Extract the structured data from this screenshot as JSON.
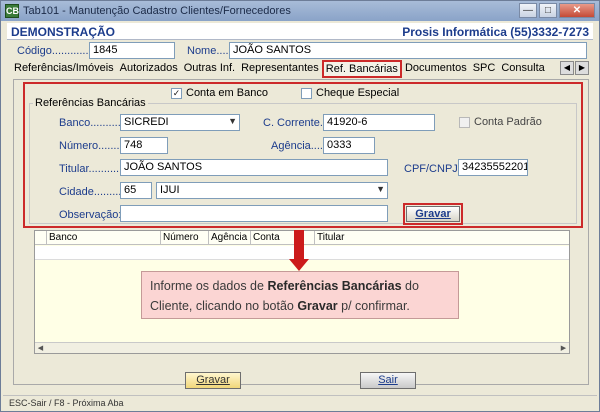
{
  "window": {
    "title": "Tab101 - Manutenção Cadastro Clientes/Fornecedores",
    "app_icon_text": "CB"
  },
  "header": {
    "demo": "DEMONSTRAÇÃO",
    "company": "Prosis Informática (55)3332-7273"
  },
  "record": {
    "codigo_label": "Código..............:",
    "codigo_value": "1845",
    "nome_label": "Nome.......:",
    "nome_value": "JOÃO SANTOS"
  },
  "tabs": [
    {
      "label": "Referências/Imóveis"
    },
    {
      "label": "Autorizados"
    },
    {
      "label": "Outras Inf."
    },
    {
      "label": "Representantes"
    },
    {
      "label": "Ref. Bancárias"
    },
    {
      "label": "Documentos"
    },
    {
      "label": "SPC"
    },
    {
      "label": "Consulta"
    }
  ],
  "options": {
    "conta_em_banco": "Conta em Banco",
    "cheque_especial": "Cheque Especial",
    "conta_padrao": "Conta Padrão"
  },
  "group_title": "Referências Bancárias",
  "form": {
    "banco_label": "Banco...........:",
    "banco_value": "SICREDI",
    "c_corrente_label": "C. Corrente...:",
    "c_corrente_value": "41920-6",
    "numero_label": "Número.........",
    "numero_value": "748",
    "agencia_label": "Agência.....:",
    "agencia_value": "0333",
    "titular_label": "Titular..............",
    "titular_value": "JOÃO SANTOS",
    "cpf_label": "CPF/CNPJ:",
    "cpf_value": "34235552201",
    "cidade_label": "Cidade..........",
    "cidade_code": "65",
    "cidade_value": "IJUI",
    "observacao_label": "Observação:",
    "observacao_value": "",
    "gravar_label": "Gravar"
  },
  "grid": {
    "columns": [
      "Banco",
      "Número",
      "Agência",
      "Conta",
      "Titular"
    ]
  },
  "note": {
    "line1_a": "Informe os dados de ",
    "line1_b": "Referências Bancárias",
    "line1_c": " do",
    "line2_a": "Cliente, clicando no botão ",
    "line2_b": "Gravar",
    "line2_c": " p/ confirmar."
  },
  "footer": {
    "gravar": "Gravar",
    "sair": "Sair",
    "status": "ESC-Sair / F8 - Próxima Aba"
  },
  "colors": {
    "accent_blue": "#1c3c8c",
    "highlight_red": "#cc2a2a",
    "note_bg": "#fbd5d3"
  }
}
